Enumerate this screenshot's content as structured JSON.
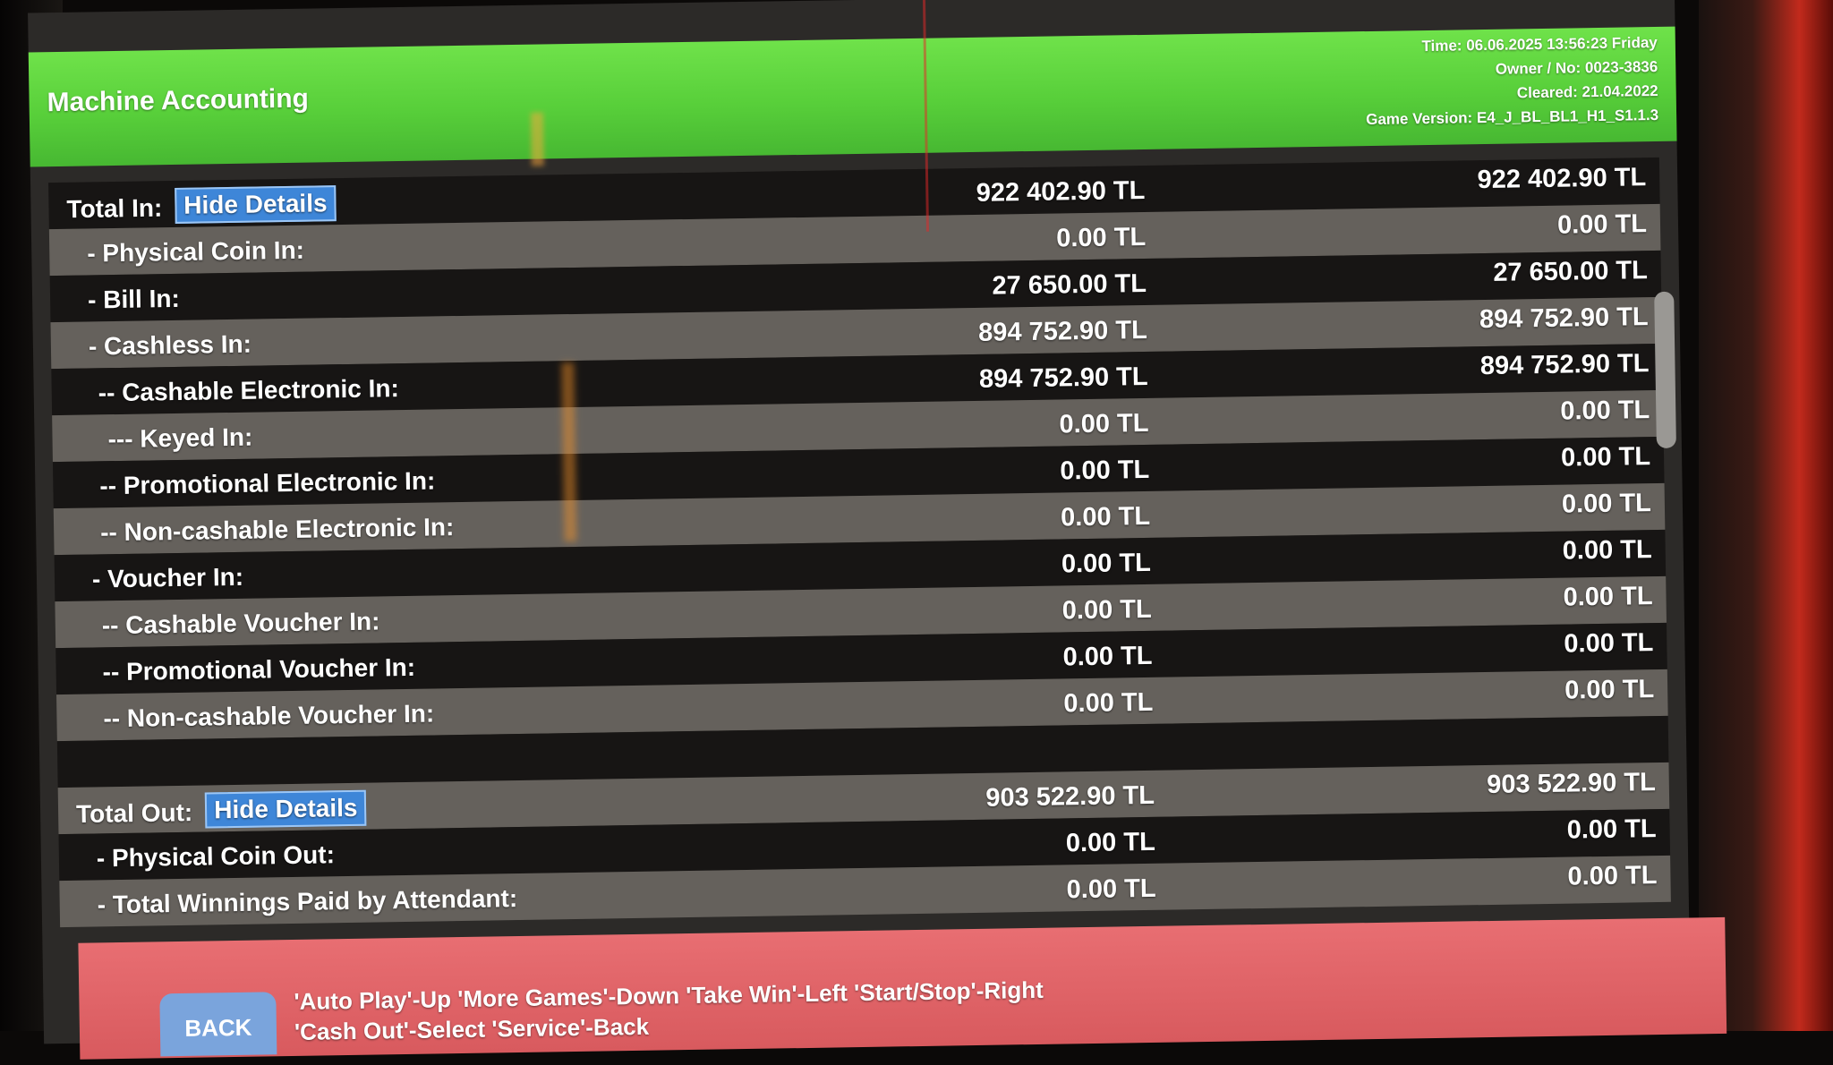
{
  "header": {
    "title": "Machine Accounting",
    "time": "Time: 06.06.2025  13:56:23  Friday",
    "owner": "Owner / No: 0023-3836",
    "cleared": "Cleared: 21.04.2022",
    "game_version": "Game Version: E4_J_BL_BL1_H1_S1.1.3"
  },
  "rows": [
    {
      "label": "Total In:",
      "button": "Hide Details",
      "v1": "922 402.90 TL",
      "v2": "922 402.90 TL"
    },
    {
      "label": "- Physical Coin In:",
      "v1": "0.00 TL",
      "v2": "0.00 TL"
    },
    {
      "label": "- Bill In:",
      "v1": "27 650.00 TL",
      "v2": "27 650.00 TL"
    },
    {
      "label": "- Cashless In:",
      "v1": "894 752.90 TL",
      "v2": "894 752.90 TL"
    },
    {
      "label": "-- Cashable Electronic In:",
      "v1": "894 752.90 TL",
      "v2": "894 752.90 TL"
    },
    {
      "label": "--- Keyed In:",
      "v1": "0.00 TL",
      "v2": "0.00 TL"
    },
    {
      "label": "-- Promotional Electronic In:",
      "v1": "0.00 TL",
      "v2": "0.00 TL"
    },
    {
      "label": "-- Non-cashable Electronic In:",
      "v1": "0.00 TL",
      "v2": "0.00 TL"
    },
    {
      "label": "- Voucher In:",
      "v1": "0.00 TL",
      "v2": "0.00 TL"
    },
    {
      "label": "-- Cashable Voucher In:",
      "v1": "0.00 TL",
      "v2": "0.00 TL"
    },
    {
      "label": "-- Promotional Voucher In:",
      "v1": "0.00 TL",
      "v2": "0.00 TL"
    },
    {
      "label": "-- Non-cashable Voucher In:",
      "v1": "0.00 TL",
      "v2": "0.00 TL"
    },
    {
      "label": "",
      "v1": "",
      "v2": ""
    },
    {
      "label": "Total Out:",
      "button": "Hide Details",
      "v1": "903 522.90 TL",
      "v2": "903 522.90 TL"
    },
    {
      "label": "- Physical Coin Out:",
      "v1": "0.00 TL",
      "v2": "0.00 TL"
    },
    {
      "label": "- Total Winnings Paid by Attendant:",
      "v1": "0.00 TL",
      "v2": "0.00 TL"
    }
  ],
  "footer": {
    "back_label": "BACK",
    "hint_line1": "'Auto Play'-Up  'More Games'-Down  'Take Win'-Left  'Start/Stop'-Right",
    "hint_line2": "'Cash Out'-Select  'Service'-Back"
  }
}
